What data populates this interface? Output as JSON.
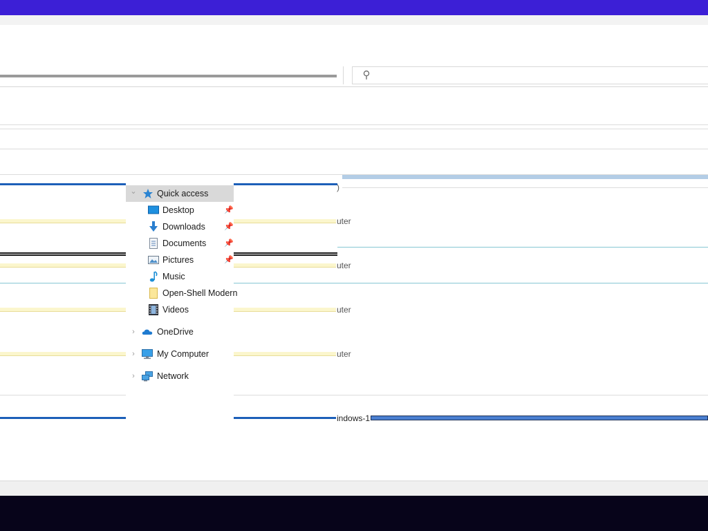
{
  "nav": {
    "quick_access": "Quick access",
    "items": [
      {
        "label": "Desktop",
        "icon": "desktop-icon",
        "pinned": true
      },
      {
        "label": "Downloads",
        "icon": "downloads-icon",
        "pinned": true
      },
      {
        "label": "Documents",
        "icon": "documents-icon",
        "pinned": true
      },
      {
        "label": "Pictures",
        "icon": "pictures-icon",
        "pinned": true
      },
      {
        "label": "Music",
        "icon": "music-icon",
        "pinned": false
      },
      {
        "label": "Open-Shell Modern",
        "icon": "folder-icon",
        "pinned": false
      },
      {
        "label": "Videos",
        "icon": "videos-icon",
        "pinned": false
      }
    ],
    "onedrive": "OneDrive",
    "my_computer": "My Computer",
    "network": "Network"
  },
  "fragments": {
    "paren": ")",
    "uter": "uter",
    "windows": "indows-1"
  },
  "glyphs": {
    "search": "⚲",
    "pin": "📌",
    "chevron_down": "⌄",
    "chevron_right": "›"
  },
  "colors": {
    "accent_top": "#3c1fd6",
    "taskbar": "#07041a",
    "selection": "#d9d9d9"
  }
}
